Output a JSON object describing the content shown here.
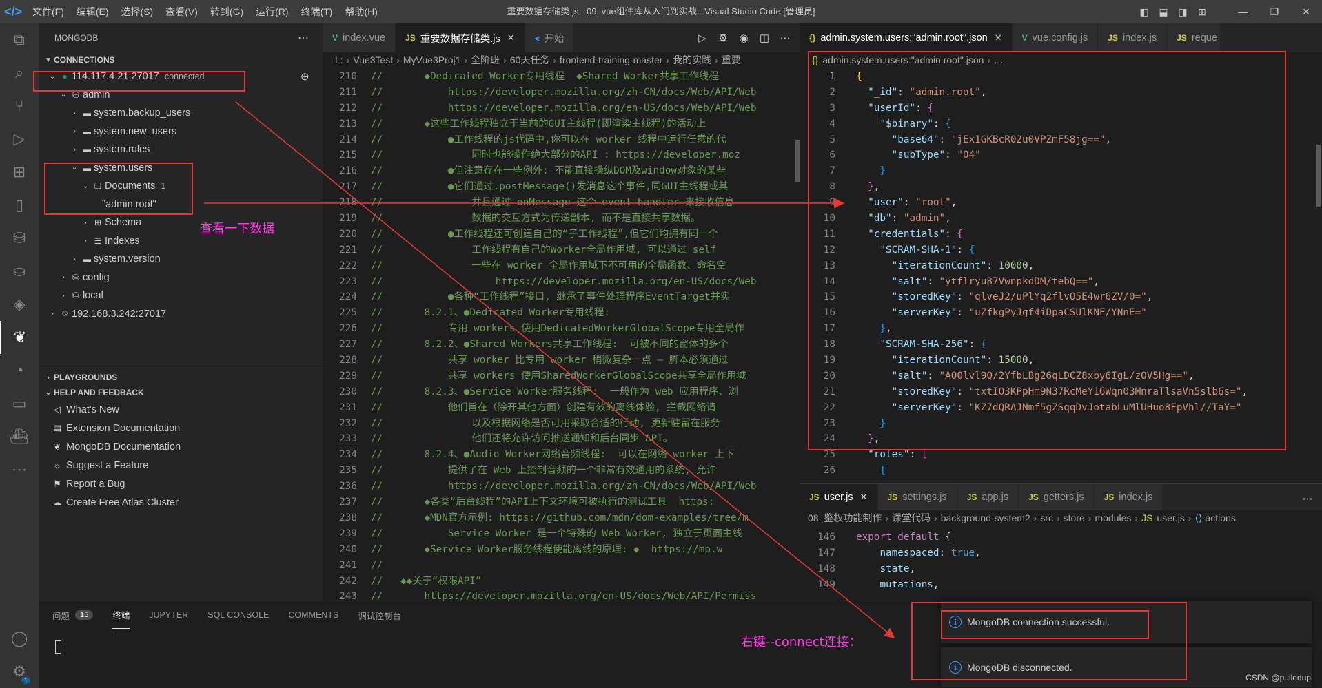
{
  "titlebar": {
    "menus": [
      "文件(F)",
      "编辑(E)",
      "选择(S)",
      "查看(V)",
      "转到(G)",
      "运行(R)",
      "终端(T)",
      "帮助(H)"
    ],
    "title": "重要数据存储类.js - 09. vue组件库从入门到实战 - Visual Studio Code [管理员]"
  },
  "sidebar": {
    "title": "MONGODB",
    "connections_header": "CONNECTIONS",
    "connection1": {
      "host": "114.117.4.21:27017",
      "status": "connected"
    },
    "tree": {
      "admin": "admin",
      "backup_users": "system.backup_users",
      "new_users": "system.new_users",
      "roles": "system.roles",
      "users": "system.users",
      "documents": "Documents",
      "documents_count": "1",
      "doc_admin_root": "\"admin.root\"",
      "schema": "Schema",
      "indexes": "Indexes",
      "version": "system.version",
      "config": "config",
      "local": "local"
    },
    "connection2": {
      "host": "192.168.3.242:27017"
    },
    "playgrounds_header": "PLAYGROUNDS",
    "help_header": "HELP AND FEEDBACK",
    "help_items": [
      "What's New",
      "Extension Documentation",
      "MongoDB Documentation",
      "Suggest a Feature",
      "Report a Bug",
      "Create Free Atlas Cluster"
    ]
  },
  "editor1": {
    "tabs": [
      {
        "label": "index.vue",
        "icon": "vue"
      },
      {
        "label": "重要数据存储类.js",
        "icon": "js"
      },
      {
        "label": "开始",
        "icon": "vscode"
      }
    ],
    "breadcrumb": [
      "L:",
      "Vue3Test",
      "MyVue3Proj1",
      "全阶班",
      "60天任务",
      "frontend-training-master",
      "我的实践",
      "重要"
    ],
    "lines": [
      {
        "n": "210",
        "t": "//       ◆Dedicated Worker专用线程  ◆Shared Worker共享工作线程"
      },
      {
        "n": "211",
        "t": "//           https://developer.mozilla.org/zh-CN/docs/Web/API/Web"
      },
      {
        "n": "212",
        "t": "//           https://developer.mozilla.org/en-US/docs/Web/API/Web"
      },
      {
        "n": "213",
        "t": "//       ◆这些工作线程独立于当前的GUI主线程(即渲染主线程)的活动上"
      },
      {
        "n": "214",
        "t": "//           ●工作线程的js代码中,你可以在 worker 线程中运行任意的代"
      },
      {
        "n": "215",
        "t": "//               同时也能操作绝大部分的API : https://developer.moz"
      },
      {
        "n": "216",
        "t": "//           ●但注意存在一些例外: 不能直接操纵DOM及window对象的某些"
      },
      {
        "n": "217",
        "t": "//           ●它们通过.postMessage()发消息这个事件,同GUI主线程或其"
      },
      {
        "n": "218",
        "t": "//               并且通过 onMessage 这个 event handler 来接收信息"
      },
      {
        "n": "219",
        "t": "//               数据的交互方式为传递副本, 而不是直接共享数据。"
      },
      {
        "n": "220",
        "t": "//           ●工作线程还可创建自己的“子工作线程”,但它们均拥有同一个"
      },
      {
        "n": "221",
        "t": "//               工作线程有自己的Worker全局作用域, 可以通过 self"
      },
      {
        "n": "222",
        "t": "//               一些在 worker 全局作用域下不可用的全局函数、命名空"
      },
      {
        "n": "223",
        "t": "//                   https://developer.mozilla.org/en-US/docs/Web"
      },
      {
        "n": "224",
        "t": "//           ●各种“工作线程”接口, 继承了事件处理程序EventTarget并实"
      },
      {
        "n": "225",
        "t": "//       8.2.1、●Dedicated Worker专用线程:"
      },
      {
        "n": "226",
        "t": "//           专用 workers 使用DedicatedWorkerGlobalScope专用全局作"
      },
      {
        "n": "227",
        "t": "//       8.2.2、●Shared Workers共享工作线程:  可被不同的窗体的多个"
      },
      {
        "n": "228",
        "t": "//           共享 worker 比专用 worker 稍微复杂一点 — 脚本必须通过"
      },
      {
        "n": "229",
        "t": "//           共享 workers 使用SharedWorkerGlobalScope共享全局作用域"
      },
      {
        "n": "230",
        "t": "//       8.2.3、●Service Worker服务线程:  一般作为 web 应用程序、浏"
      },
      {
        "n": "231",
        "t": "//           他们旨在（除开其他方面）创建有效的离线体验, 拦截网络请"
      },
      {
        "n": "232",
        "t": "//               以及根据网络是否可用采取合适的行动, 更新驻留在服务"
      },
      {
        "n": "233",
        "t": "//               他们还将允许访问推送通知和后台同步 API。"
      },
      {
        "n": "234",
        "t": "//       8.2.4、●Audio Worker网络音频线程:  可以在网络 worker 上下"
      },
      {
        "n": "235",
        "t": "//           提供了在 Web 上控制音频的一个非常有效通用的系统, 允许"
      },
      {
        "n": "236",
        "t": "//           https://developer.mozilla.org/zh-CN/docs/Web/API/Web"
      },
      {
        "n": "237",
        "t": "//       ◆各类“后台线程”的API上下文环境可被执行的测试工具  https:"
      },
      {
        "n": "238",
        "t": "//       ◆MDN官方示例: https://github.com/mdn/dom-examples/tree/m"
      },
      {
        "n": "239",
        "t": "//           Service Worker 是一个特殊的 Web Worker, 独立于页面主线"
      },
      {
        "n": "240",
        "t": "//       ◆Service Worker服务线程使能离线的原理: ◆  https://mp.w"
      },
      {
        "n": "241",
        "t": "//"
      },
      {
        "n": "242",
        "t": "//   ◆◆关于“权限API”"
      },
      {
        "n": "243",
        "t": "//       https://developer.mozilla.org/en-US/docs/Web/API/Permiss"
      }
    ]
  },
  "editor2": {
    "tabs": [
      {
        "label": "admin.system.users:\"admin.root\".json",
        "icon": "json"
      },
      {
        "label": "vue.config.js",
        "icon": "vue"
      },
      {
        "label": "index.js",
        "icon": "js"
      },
      {
        "label": "reque",
        "icon": "js"
      }
    ],
    "breadcrumb": "admin.system.users:\"admin.root\".json",
    "json_lines": [
      {
        "n": "1"
      },
      {
        "n": "2"
      },
      {
        "n": "3"
      },
      {
        "n": "4"
      },
      {
        "n": "5"
      },
      {
        "n": "6"
      },
      {
        "n": "7"
      },
      {
        "n": "8"
      },
      {
        "n": "9"
      },
      {
        "n": "10"
      },
      {
        "n": "11"
      },
      {
        "n": "12"
      },
      {
        "n": "13"
      },
      {
        "n": "14"
      },
      {
        "n": "15"
      },
      {
        "n": "16"
      },
      {
        "n": "17"
      },
      {
        "n": "18"
      },
      {
        "n": "19"
      },
      {
        "n": "20"
      },
      {
        "n": "21"
      },
      {
        "n": "22"
      },
      {
        "n": "23"
      },
      {
        "n": "24"
      },
      {
        "n": "25"
      },
      {
        "n": "26"
      }
    ],
    "doc": {
      "_id": "\"admin.root\"",
      "userId": "userId",
      "binary": "$binary",
      "base64_key": "base64",
      "base64": "\"jEx1GKBcR02u0VPZmF58jg==\"",
      "subType_key": "subType",
      "subType": "\"04\"",
      "user_key": "user",
      "user": "\"root\"",
      "db_key": "db",
      "db": "\"admin\"",
      "credentials_key": "credentials",
      "sha1_key": "SCRAM-SHA-1",
      "sha1_iter": "10000",
      "sha1_salt": "\"ytflryu87VwnpkdDM/tebQ==\"",
      "sha1_stored": "\"qlveJ2/uPlYq2flvO5E4wr6ZV/0=\"",
      "sha1_server": "\"uZfkgPyJgf4iDpaCSUlKNF/YNnE=\"",
      "sha256_key": "SCRAM-SHA-256",
      "sha256_iter": "15000",
      "sha256_salt": "\"AO0lvl9Q/2YfbLBg26qLDCZ8xby6IgL/zOV5Hg==\"",
      "sha256_stored": "\"txtIO3KPpHm9N37RcMeY16Wqn03MnraTlsaVn5slb6s=\"",
      "sha256_server": "\"KZ7dQRAJNmf5gZSqqDvJotabLuMlUHuo8FpVhl//TaY=\"",
      "roles_key": "roles",
      "k_iterationCount": "iterationCount",
      "k_salt": "salt",
      "k_storedKey": "storedKey",
      "k_serverKey": "serverKey",
      "k_id": "_id"
    }
  },
  "editor3": {
    "tabs": [
      {
        "label": "user.js",
        "icon": "js"
      },
      {
        "label": "settings.js",
        "icon": "js"
      },
      {
        "label": "app.js",
        "icon": "js"
      },
      {
        "label": "getters.js",
        "icon": "js"
      },
      {
        "label": "index.js",
        "icon": "js"
      }
    ],
    "breadcrumb": [
      "08. 鉴权功能制作",
      "课堂代码",
      "background-system2",
      "src",
      "store",
      "modules",
      "user.js",
      "actions"
    ],
    "lines": [
      {
        "n": "146",
        "k1": "export",
        "k2": "default",
        "rest": " {"
      },
      {
        "n": "147",
        "prop": "namespaced",
        "val": "true"
      },
      {
        "n": "148",
        "prop": "state"
      },
      {
        "n": "149",
        "prop": "mutations"
      }
    ]
  },
  "panel": {
    "tabs": [
      "问题",
      "终端",
      "JUPYTER",
      "SQL CONSOLE",
      "COMMENTS",
      "调试控制台"
    ],
    "problems_count": "15"
  },
  "notifications": [
    "MongoDB connection successful.",
    "MongoDB disconnected."
  ],
  "annotations": {
    "view_data": "查看一下数据",
    "right_click": "右键--connect连接："
  },
  "watermark": "CSDN @pulledup",
  "colors": {
    "annotation_red": "#e53935",
    "annotation_magenta": "#ff3ce6",
    "accent": "#3794ff"
  }
}
